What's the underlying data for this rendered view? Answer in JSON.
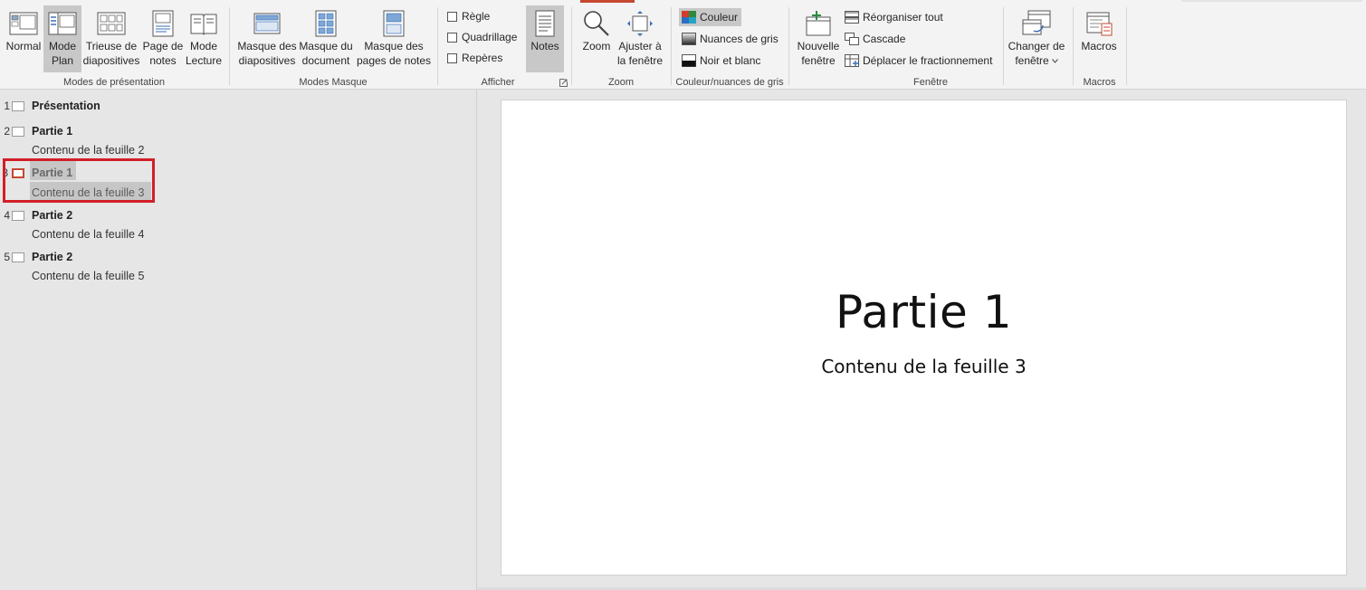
{
  "ribbon": {
    "groups": {
      "presentation_modes": {
        "label": "Modes de présentation",
        "normal": "Normal",
        "outline_l1": "Mode",
        "outline_l2": "Plan",
        "sorter_l1": "Trieuse de",
        "sorter_l2": "diapositives",
        "notes_page_l1": "Page de",
        "notes_page_l2": "notes",
        "reading_l1": "Mode",
        "reading_l2": "Lecture"
      },
      "master_modes": {
        "label": "Modes Masque",
        "slide_master_l1": "Masque des",
        "slide_master_l2": "diapositives",
        "handout_master_l1": "Masque du",
        "handout_master_l2": "document",
        "notes_master_l1": "Masque des",
        "notes_master_l2": "pages de notes"
      },
      "show": {
        "label": "Afficher",
        "ruler": "Règle",
        "gridlines": "Quadrillage",
        "guides": "Repères",
        "notes": "Notes"
      },
      "zoom": {
        "label": "Zoom",
        "zoom": "Zoom",
        "fit_l1": "Ajuster à",
        "fit_l2": "la fenêtre"
      },
      "color": {
        "label": "Couleur/nuances de gris",
        "color": "Couleur",
        "grayscale": "Nuances de gris",
        "bw": "Noir et blanc"
      },
      "window": {
        "label": "Fenêtre",
        "new_window_l1": "Nouvelle",
        "new_window_l2": "fenêtre",
        "arrange_all": "Réorganiser tout",
        "cascade": "Cascade",
        "move_split": "Déplacer le fractionnement",
        "switch_l1": "Changer de",
        "switch_l2": "fenêtre"
      },
      "macros": {
        "label": "Macros",
        "macros": "Macros"
      }
    },
    "icons": {
      "normal": "normal-view-icon",
      "outline": "outline-view-icon",
      "sorter": "slide-sorter-icon",
      "notes_page": "notes-page-icon",
      "reading": "reading-view-icon",
      "zoom": "magnifier-icon",
      "fit": "fit-to-window-icon",
      "new_window": "new-window-icon",
      "macros": "macros-icon"
    },
    "colors": {
      "accent": "#c4472f",
      "active_bg": "#c8c8c8"
    }
  },
  "outline": {
    "items": [
      {
        "num": "1",
        "title": "Présentation",
        "body": ""
      },
      {
        "num": "2",
        "title": "Partie 1",
        "body": "Contenu de la feuille 2"
      },
      {
        "num": "3",
        "title": "Partie 1",
        "body": "Contenu de la feuille 3"
      },
      {
        "num": "4",
        "title": "Partie 2",
        "body": "Contenu de la feuille 4"
      },
      {
        "num": "5",
        "title": "Partie 2",
        "body": "Contenu de la feuille 5"
      }
    ],
    "selected_index": 3,
    "highlight_color": "#d21f27"
  },
  "slide": {
    "title": "Partie 1",
    "subtitle": "Contenu de la feuille 3"
  }
}
